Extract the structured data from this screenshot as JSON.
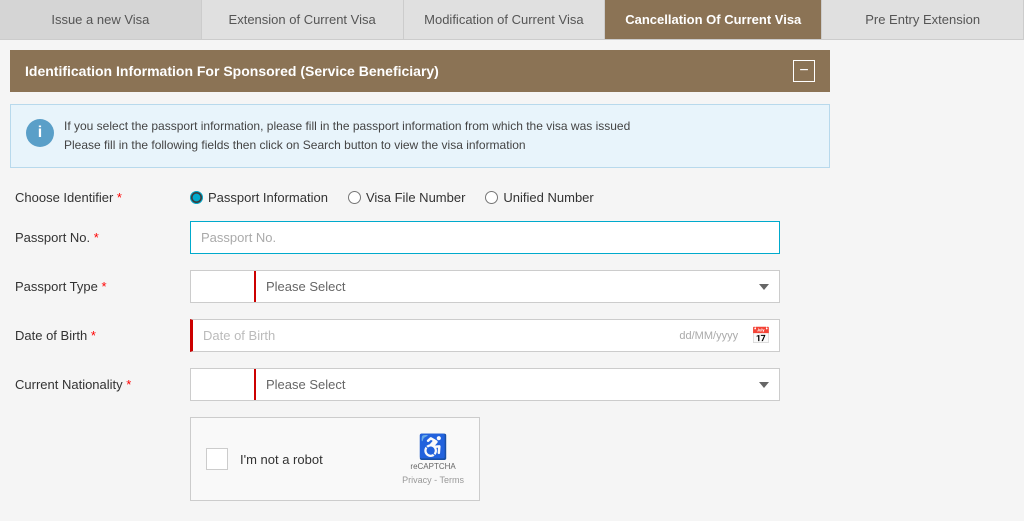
{
  "tabs": [
    {
      "id": "issue-new-visa",
      "label": "Issue a new Visa",
      "active": false
    },
    {
      "id": "extension",
      "label": "Extension of Current Visa",
      "active": false
    },
    {
      "id": "modification",
      "label": "Modification of Current Visa",
      "active": false
    },
    {
      "id": "cancellation",
      "label": "Cancellation Of Current Visa",
      "active": true
    },
    {
      "id": "pre-entry",
      "label": "Pre Entry Extension",
      "active": false
    }
  ],
  "section": {
    "title": "Identification Information For Sponsored (Service Beneficiary)",
    "minus_label": "−"
  },
  "info": {
    "icon": "i",
    "line1": "If you select the passport information, please fill in the passport information from which the visa was issued",
    "line2": "Please fill in the following fields then click on Search button to view the visa information"
  },
  "form": {
    "identifier_label": "Choose Identifier",
    "identifier_options": [
      {
        "id": "passport",
        "label": "Passport Information",
        "checked": true
      },
      {
        "id": "visa-file",
        "label": "Visa File Number",
        "checked": false
      },
      {
        "id": "unified",
        "label": "Unified Number",
        "checked": false
      }
    ],
    "passport_no_label": "Passport No.",
    "passport_no_placeholder": "Passport No.",
    "passport_type_label": "Passport Type",
    "passport_type_placeholder": "Please Select",
    "date_of_birth_label": "Date of Birth",
    "date_of_birth_placeholder": "Date of Birth",
    "date_format_hint": "dd/MM/yyyy",
    "current_nationality_label": "Current Nationality",
    "current_nationality_placeholder": "Please Select",
    "captcha": {
      "checkbox_label": "I'm not a robot",
      "brand": "reCAPTCHA",
      "footer": "Privacy - Terms"
    }
  }
}
